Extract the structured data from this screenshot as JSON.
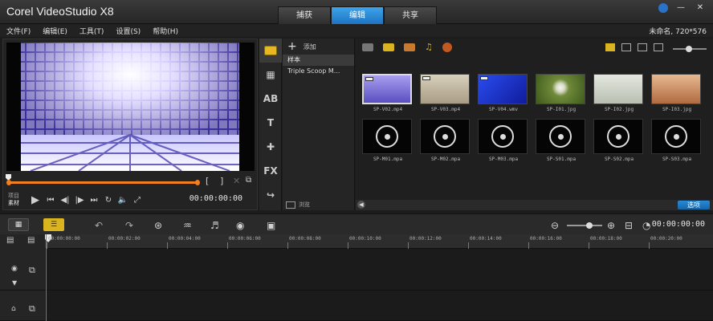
{
  "app": {
    "title": "Corel VideoStudio X8",
    "steps": [
      {
        "label": "捕获"
      },
      {
        "label": "编辑",
        "active": true
      },
      {
        "label": "共享"
      }
    ],
    "window_controls": [
      "?",
      "—",
      "✕"
    ]
  },
  "menu": {
    "items": [
      "文件(F)",
      "编辑(E)",
      "工具(T)",
      "设置(S)",
      "帮助(H)"
    ],
    "project_info": "未命名, 720*576"
  },
  "preview": {
    "mode_labels": [
      "项目",
      "素材"
    ],
    "timecode": "00:00:00:00",
    "mark_in": "[",
    "mark_out": "]"
  },
  "library": {
    "add_label": "添加",
    "folders": [
      {
        "label": "样本",
        "active": true
      },
      {
        "label": "Triple Scoop M..."
      }
    ],
    "browse_label": "浏览",
    "options_label": "选项",
    "tab_labels": {
      "text": "T",
      "fx": "FX",
      "title": "AB"
    },
    "thumbnails": [
      {
        "caption": "SP-V02.mp4",
        "kind": "video",
        "active": true,
        "color": "#7a6ad0"
      },
      {
        "caption": "SP-V03.mp4",
        "kind": "video",
        "color": "#cfc6b2"
      },
      {
        "caption": "SP-V04.wmv",
        "kind": "video",
        "color": "#1a2fc8"
      },
      {
        "caption": "SP-I01.jpg",
        "kind": "image",
        "color": "#6f8a3a"
      },
      {
        "caption": "SP-I02.jpg",
        "kind": "image",
        "color": "#c8cfc4"
      },
      {
        "caption": "SP-I03.jpg",
        "kind": "image",
        "color": "#c98a60"
      },
      {
        "caption": "SP-M01.mpa",
        "kind": "music"
      },
      {
        "caption": "SP-M02.mpa",
        "kind": "music"
      },
      {
        "caption": "SP-M03.mpa",
        "kind": "music"
      },
      {
        "caption": "SP-S01.mpa",
        "kind": "music"
      },
      {
        "caption": "SP-S02.mpa",
        "kind": "music"
      },
      {
        "caption": "SP-S03.mpa",
        "kind": "music"
      }
    ]
  },
  "timeline": {
    "timecode": "00:00:00:00",
    "ruler_labels": [
      "00:00:00:00",
      "00:00:02:00",
      "00:00:04:00",
      "00:00:06:00",
      "00:00:08:00",
      "00:00:10:00",
      "00:00:12:00",
      "00:00:14:00",
      "00:00:16:00",
      "00:00:18:00",
      "00:00:20:00"
    ]
  },
  "colors": {
    "accent": "#1d73c2",
    "trim": "#f08020",
    "storyboard": "#d9b320"
  }
}
